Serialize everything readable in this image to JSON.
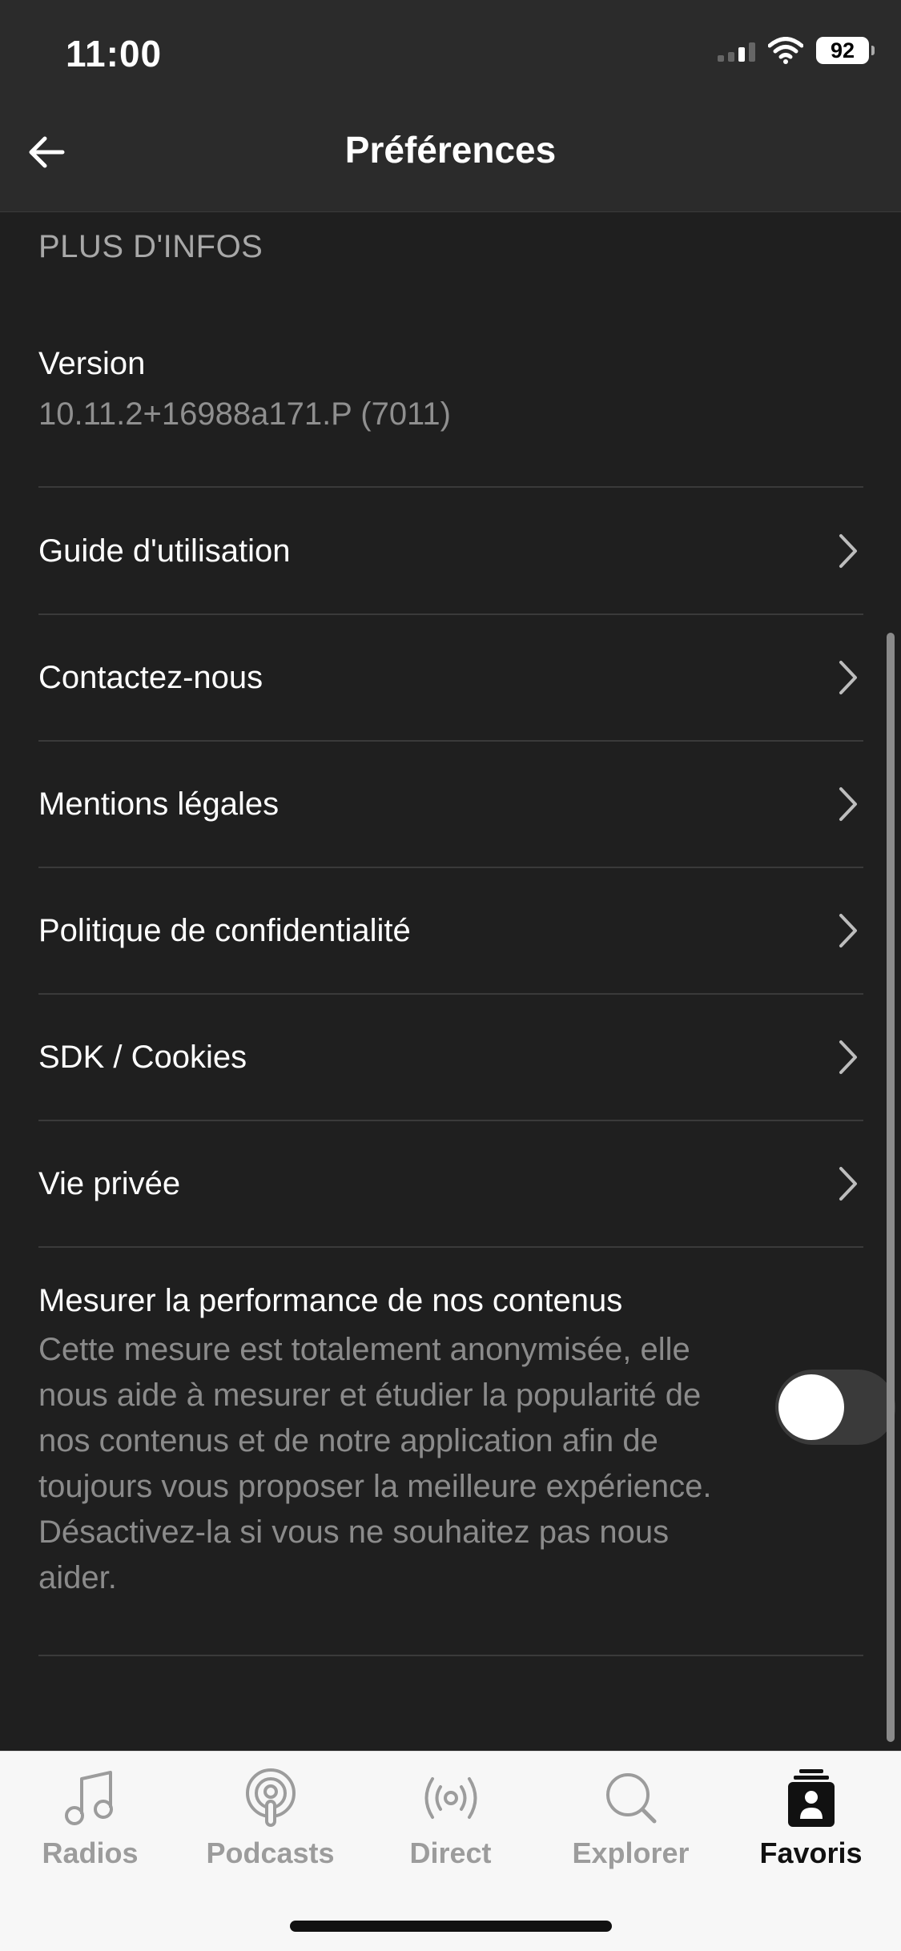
{
  "status": {
    "time": "11:00",
    "battery": "92"
  },
  "header": {
    "title": "Préférences"
  },
  "section": {
    "title": "PLUS D'INFOS"
  },
  "version": {
    "label": "Version",
    "value": "10.11.2+16988a171.P (7011)"
  },
  "items": [
    {
      "label": "Guide d'utilisation"
    },
    {
      "label": "Contactez-nous"
    },
    {
      "label": "Mentions légales"
    },
    {
      "label": "Politique de confidentialité"
    },
    {
      "label": "SDK / Cookies"
    },
    {
      "label": "Vie privée"
    }
  ],
  "performance": {
    "title": "Mesurer la performance de nos contenus",
    "description": "Cette mesure est totalement anonymisée, elle nous aide à mesurer et étudier la popularité de nos contenus et de notre application afin de toujours vous proposer la meilleure expérience. Désactivez-la si vous ne souhaitez pas nous aider.",
    "enabled": false
  },
  "tabs": [
    {
      "label": "Radios",
      "icon": "music-note-icon",
      "active": false
    },
    {
      "label": "Podcasts",
      "icon": "podcast-icon",
      "active": false
    },
    {
      "label": "Direct",
      "icon": "broadcast-icon",
      "active": false
    },
    {
      "label": "Explorer",
      "icon": "search-icon",
      "active": false
    },
    {
      "label": "Favoris",
      "icon": "favorites-icon",
      "active": true
    }
  ]
}
